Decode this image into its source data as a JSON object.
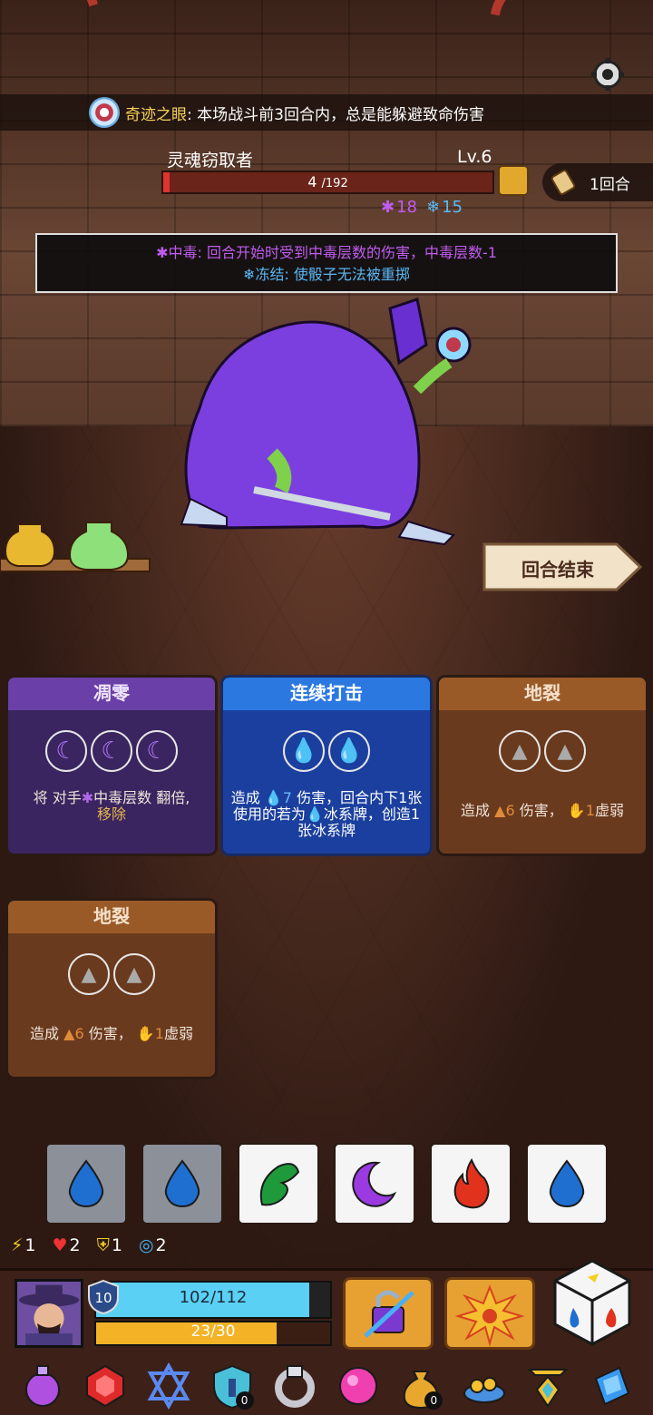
{
  "artifact": {
    "icon": "eye-artifact-icon",
    "name": "奇迹之眼",
    "description": ": 本场战斗前3回合内，总是能躲避致命伤害"
  },
  "settings": {
    "icon": "gear-icon"
  },
  "enemy": {
    "name": "灵魂窃取者",
    "level": "Lv.6",
    "hp_current": "4",
    "hp_max": "/192",
    "hp_fraction": 0.02,
    "poison": "18",
    "freeze": "15",
    "intent_icon": "intent-icon"
  },
  "round": {
    "text": "1回合",
    "icon": "scroll-icon"
  },
  "tooltip": {
    "line1": "中毒: 回合开始时受到中毒层数的伤害，中毒层数-1",
    "line2": "冻结: 使骰子无法被重掷"
  },
  "end_turn_label": "回合结束",
  "cards": [
    {
      "title": "凋零",
      "desc_a": "将 对手",
      "desc_b": "中毒层数 翻倍,",
      "desc_c": "移除"
    },
    {
      "title": "连续打击",
      "desc_a": "造成",
      "desc_num": "7",
      "desc_b": "伤害，回合内下1张使用的若为",
      "desc_c": "冰系牌，创造1张冰系牌"
    },
    {
      "title": "地裂",
      "desc_a": "造成",
      "desc_num": "6",
      "desc_b": "伤害，",
      "desc_num2": "1",
      "desc_c": "虚弱"
    },
    {
      "title": "地裂",
      "desc_a": "造成",
      "desc_num": "6",
      "desc_b": "伤害，",
      "desc_num2": "1",
      "desc_c": "虚弱"
    }
  ],
  "dice": [
    {
      "type": "water",
      "state": "used",
      "color": "#1f6fd0"
    },
    {
      "type": "water",
      "state": "used",
      "color": "#1f6fd0"
    },
    {
      "type": "wind",
      "state": "available",
      "color": "#1f9a3a"
    },
    {
      "type": "moon",
      "state": "available",
      "color": "#9a3ae0"
    },
    {
      "type": "fire",
      "state": "available",
      "color": "#e0321c"
    },
    {
      "type": "water",
      "state": "available",
      "color": "#1f6fd0"
    }
  ],
  "player_stats": {
    "energy": "1",
    "armor_heart": "2",
    "shield": "1",
    "reroll": "2"
  },
  "player": {
    "level": "10",
    "hp_text": "102/112",
    "hp_fraction": 0.91,
    "xp_text": "23/30",
    "xp_fraction": 0.77
  },
  "skills": [
    {
      "icon": "lock-swap-icon"
    },
    {
      "icon": "explosion-icon"
    }
  ],
  "relics": [
    {
      "icon": "potion-flask-icon"
    },
    {
      "icon": "ruby-gem-icon"
    },
    {
      "icon": "hexagram-icon"
    },
    {
      "icon": "shield-amulet-icon",
      "count": "0"
    },
    {
      "icon": "silver-ring-icon"
    },
    {
      "icon": "pink-orb-icon"
    },
    {
      "icon": "money-bag-icon",
      "count": "0"
    },
    {
      "icon": "dice-plate-icon"
    },
    {
      "icon": "golden-pendant-icon"
    },
    {
      "icon": "blue-crystal-icon"
    }
  ]
}
